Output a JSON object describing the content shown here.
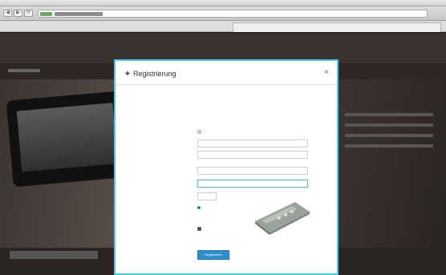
{
  "browser": {
    "title": "",
    "nav": {
      "back": "◀",
      "forward": "▶"
    },
    "url": {
      "display": ""
    }
  },
  "page": {
    "hero_title": "",
    "side_links": [
      "",
      "",
      "",
      ""
    ]
  },
  "modal": {
    "title": "Registrierung",
    "close": "×",
    "subtitle": "",
    "intro": "",
    "fields": {
      "anrede": {
        "label": "",
        "option": ""
      },
      "vorname": {
        "label": "",
        "value": ""
      },
      "nachname": {
        "label": "",
        "value": ""
      },
      "email": {
        "label": "",
        "value": ""
      },
      "email2": {
        "label": "",
        "value": ""
      },
      "card": {
        "label": "",
        "value": ""
      }
    },
    "help_link": "",
    "terms": {
      "text": "",
      "link": ""
    },
    "submit": "Registrieren"
  },
  "colors": {
    "accent": "#4dc4e8",
    "button": "#2f8fc9",
    "link": "#2a7fb8"
  }
}
